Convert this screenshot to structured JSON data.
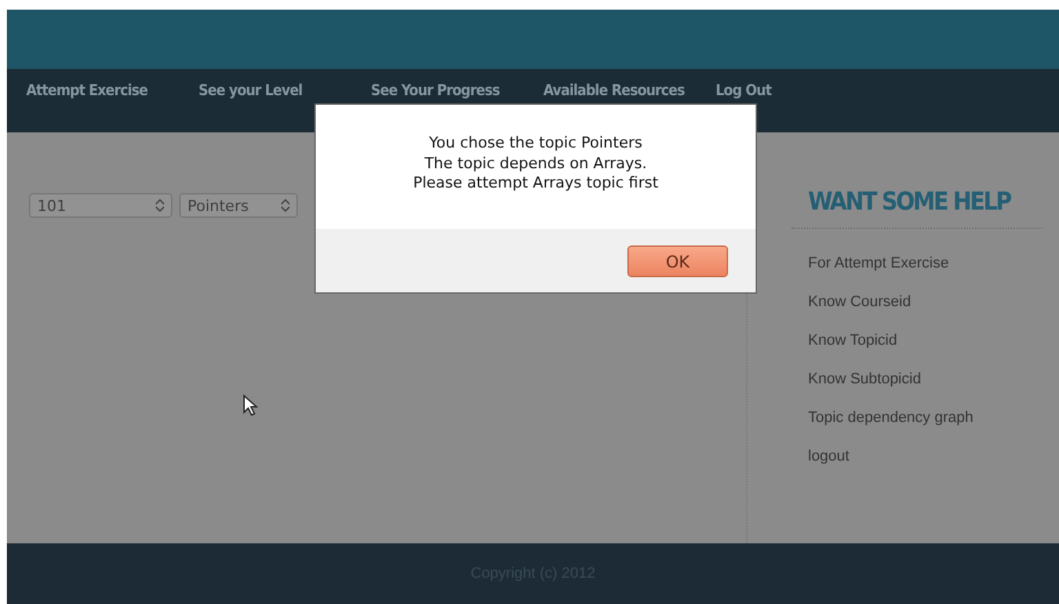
{
  "nav": {
    "items": [
      "Attempt Exercise",
      "See your Level",
      "See Your Progress",
      "Available Resources",
      "Log Out"
    ]
  },
  "selects": [
    {
      "value": "101"
    },
    {
      "value": "Pointers"
    }
  ],
  "sidebar": {
    "title": "WANT SOME HELP",
    "links": [
      "For Attempt Exercise",
      "Know Courseid",
      "Know Topicid",
      "Know Subtopicid",
      "Topic dependency graph",
      "logout"
    ]
  },
  "footer": "Copyright (c) 2012",
  "dialog": {
    "lines": [
      "You chose the topic Pointers",
      "The topic depends on Arrays.",
      "Please attempt Arrays topic first"
    ],
    "button": "OK"
  }
}
